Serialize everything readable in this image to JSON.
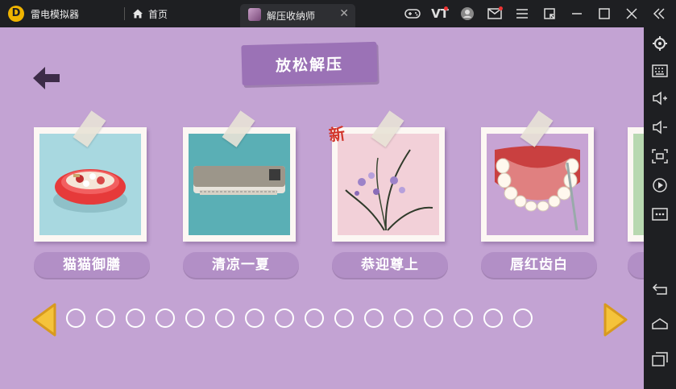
{
  "titlebar": {
    "app_name": "雷电模拟器",
    "logo_char": "D",
    "home_tab_label": "首页",
    "active_tab_title": "解压收纳师",
    "close_glyph": "✕",
    "vt_label": "VT"
  },
  "game": {
    "title": "放松解压",
    "new_badge": "新",
    "cards": [
      {
        "label": "猫猫御膳"
      },
      {
        "label": "清凉一夏"
      },
      {
        "label": "恭迎尊上"
      },
      {
        "label": "唇红齿白"
      }
    ],
    "page_dot_count": 16
  },
  "colors": {
    "background": "#c3a3d3",
    "banner": "#9b72b6",
    "label_pill": "#b28fc6",
    "nav_arrow": "#f5c33b",
    "new_badge": "#d2352b",
    "chrome": "#1e1f22"
  },
  "icons": {
    "titlebar": [
      "gamepad-icon",
      "vt-icon",
      "user-icon",
      "mail-icon",
      "menu-icon",
      "shrink-icon",
      "minimize-icon",
      "maximize-icon",
      "close-icon",
      "collapse-icon"
    ],
    "sidebar": [
      "settings-icon",
      "keyboard-icon",
      "volume-up-icon",
      "volume-down-icon",
      "screenshot-icon",
      "record-icon",
      "more-icon",
      "back-icon",
      "home-icon",
      "recent-apps-icon"
    ]
  }
}
